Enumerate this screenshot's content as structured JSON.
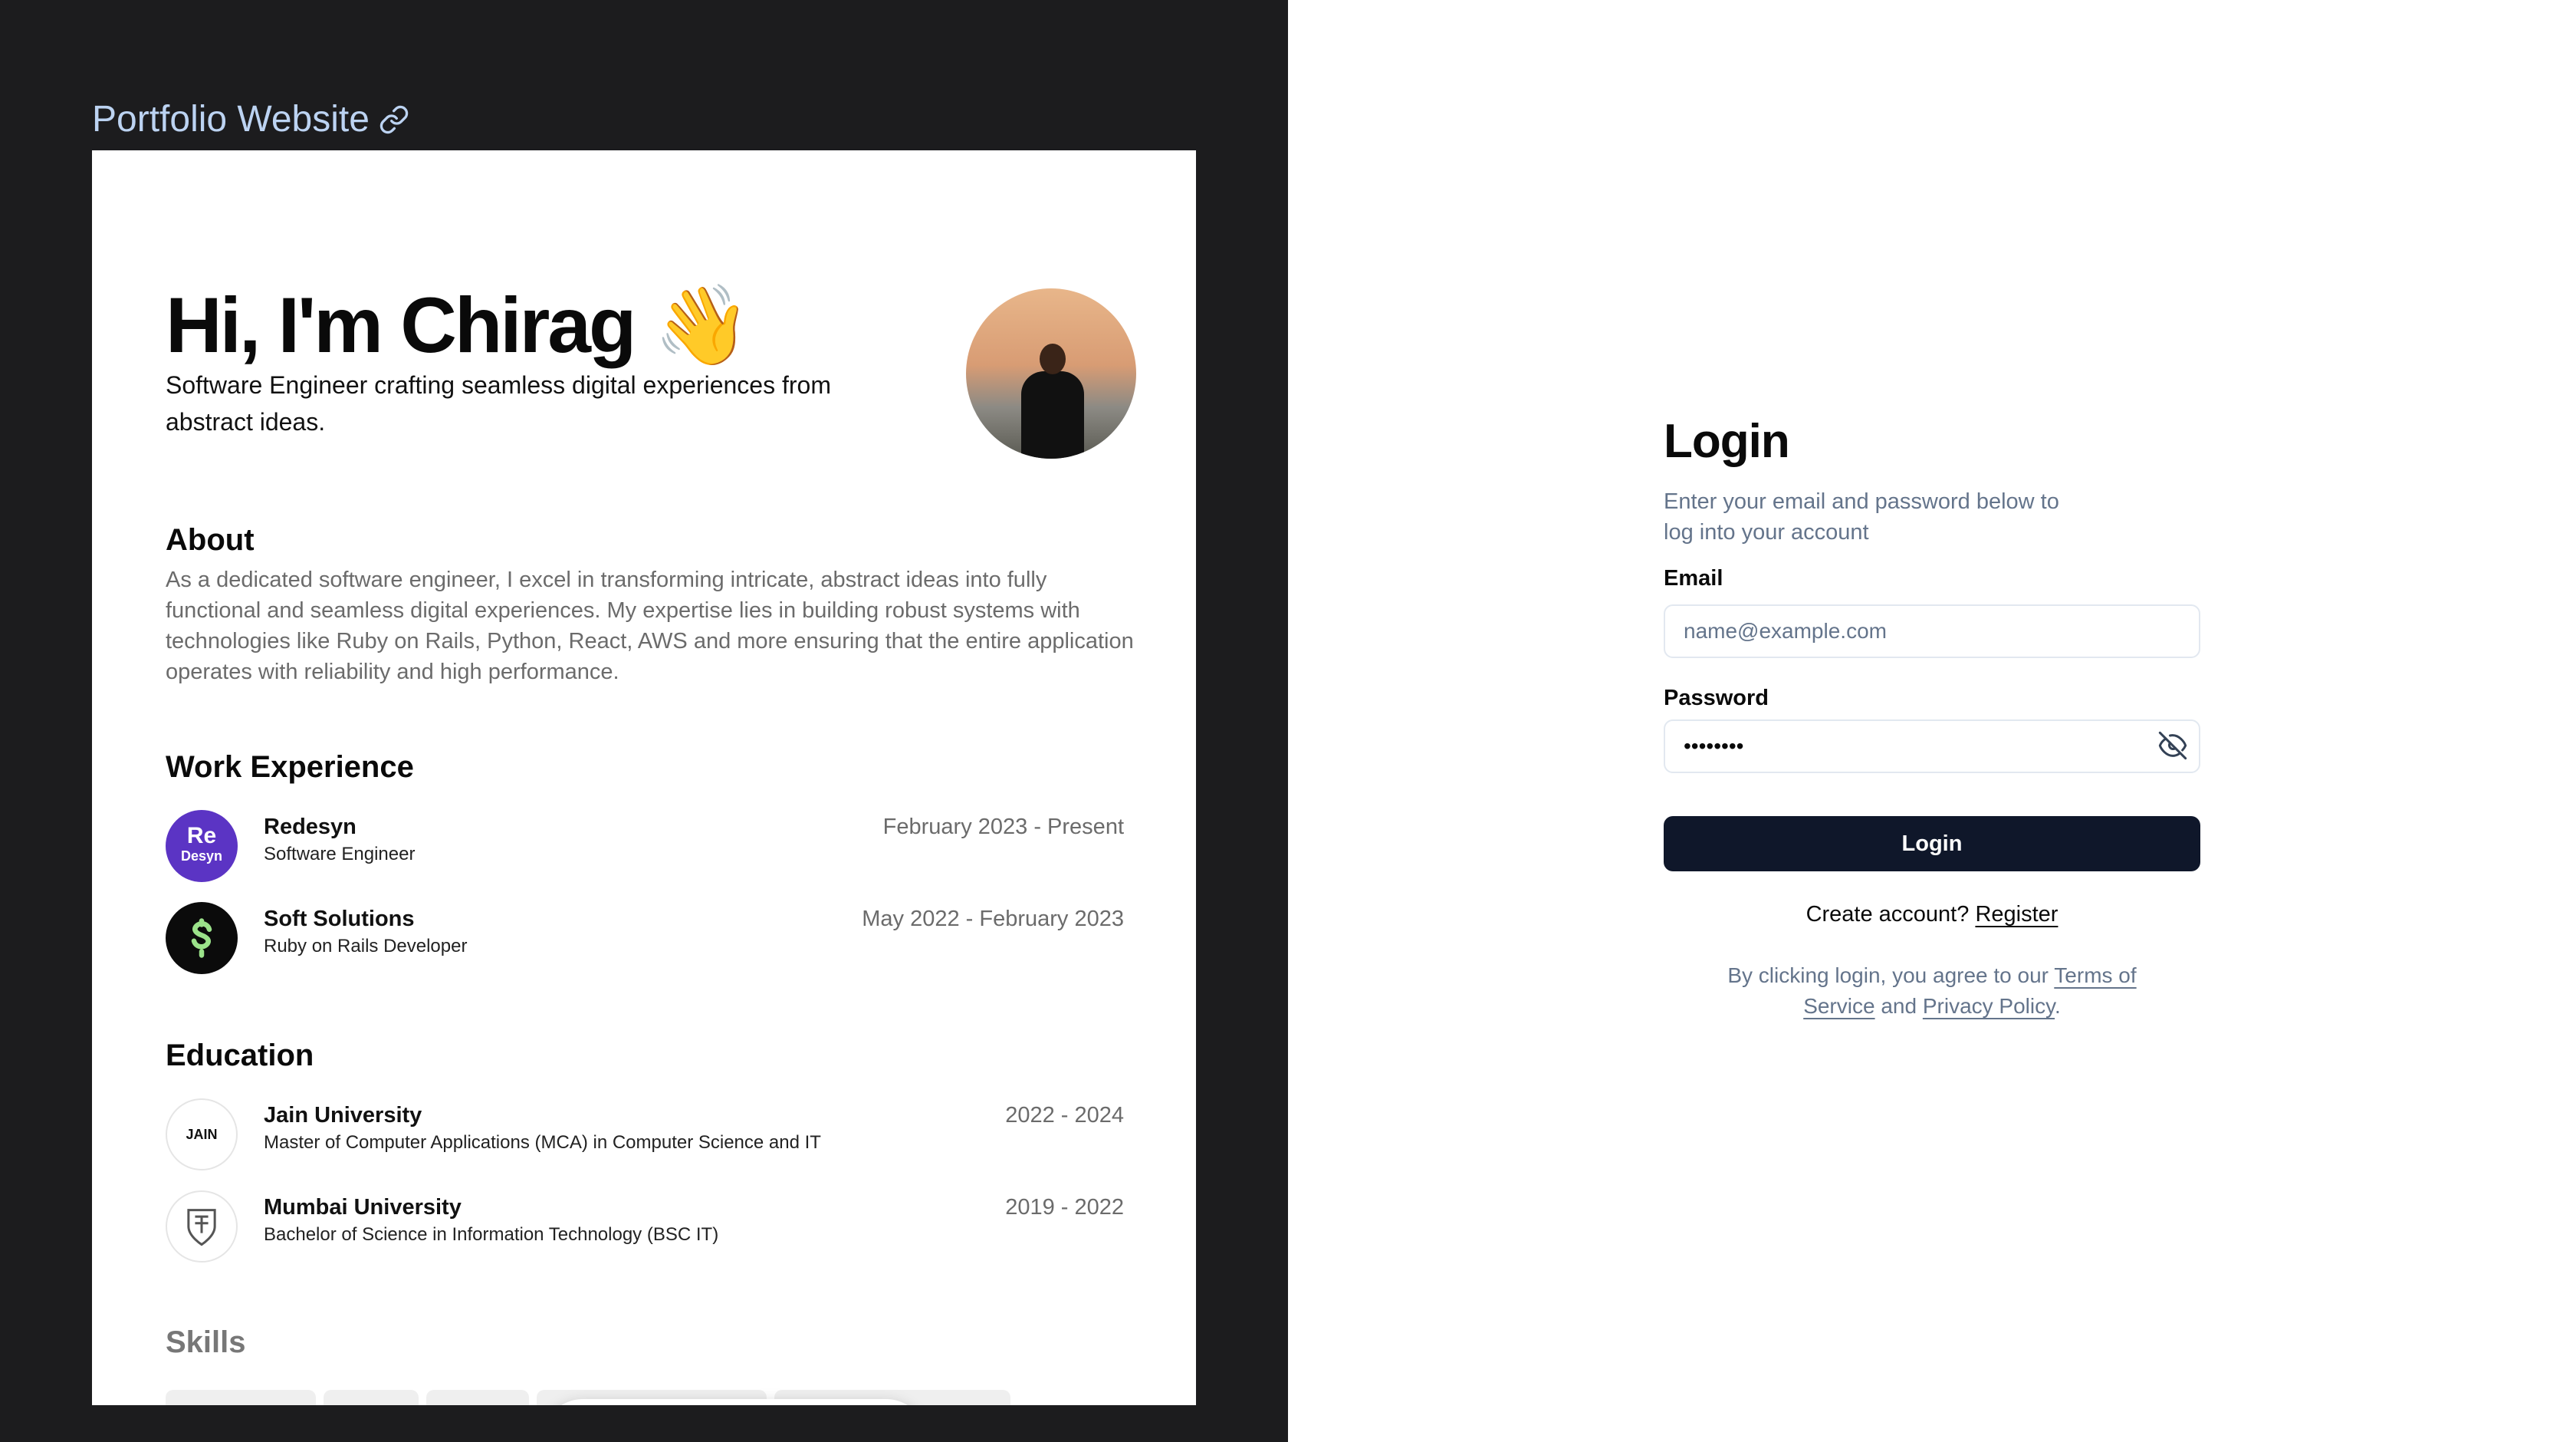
{
  "portfolio": {
    "link_label": "Portfolio Website",
    "hero_name": "Hi, I'm Chirag 👋",
    "hero_subtitle": "Software Engineer crafting seamless digital experiences from abstract ideas.",
    "about": {
      "title": "About",
      "text": "As a dedicated software engineer, I excel in transforming intricate, abstract ideas into fully functional and seamless digital experiences. My expertise lies in building robust systems with technologies like Ruby on Rails, Python, React, AWS and more ensuring that the entire application operates with reliability and high performance."
    },
    "work": {
      "title": "Work Experience",
      "items": [
        {
          "org": "Redesyn",
          "role": "Software Engineer",
          "dates": "February 2023 - Present",
          "logo_text": "Re",
          "logo_sub": "Desyn"
        },
        {
          "org": "Soft Solutions",
          "role": "Ruby on Rails Developer",
          "dates": "May 2022 - February 2023"
        }
      ]
    },
    "education": {
      "title": "Education",
      "items": [
        {
          "org": "Jain University",
          "role": "Master of Computer Applications (MCA) in Computer Science and IT",
          "dates": "2022 - 2024",
          "logo_text": "JAIN"
        },
        {
          "org": "Mumbai University",
          "role": "Bachelor of Science in Information Technology (BSC IT)",
          "dates": "2019 - 2022"
        }
      ]
    },
    "skills_title": "Skills",
    "dock_icons": [
      "home-icon",
      "github-icon",
      "linkedin-icon",
      "x-icon",
      "mail-icon",
      "sun-icon"
    ]
  },
  "login": {
    "title": "Login",
    "description": "Enter your email and password below to log into your account",
    "email_label": "Email",
    "email_placeholder": "name@example.com",
    "password_label": "Password",
    "password_value": "••••••••",
    "button_label": "Login",
    "create_prefix": "Create account?",
    "register_link": "Register",
    "terms_prefix": "By clicking login, you agree to our",
    "terms_link": "Terms of Service",
    "terms_and": "and",
    "privacy_link": "Privacy Policy",
    "terms_suffix": "."
  },
  "colors": {
    "left_bg": "#1c1c1e",
    "link": "#bcd3f2",
    "button_bg": "#0f172a",
    "muted": "#64748b",
    "redesyn_purple": "#5b34c4",
    "soft_green": "#9be28a"
  }
}
